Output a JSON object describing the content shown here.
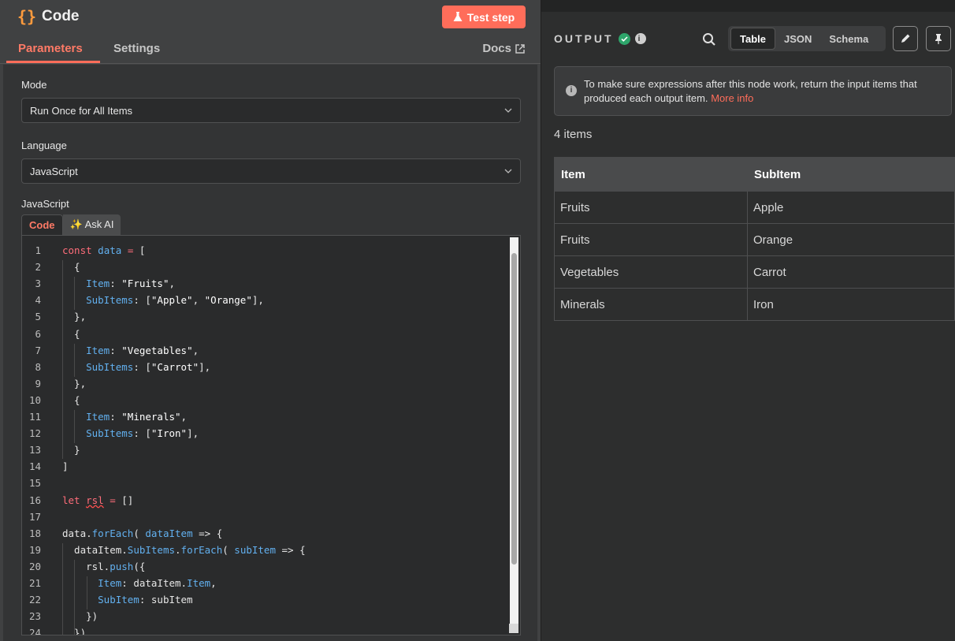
{
  "node": {
    "title": "Code",
    "test_label": "Test step"
  },
  "tabs": {
    "parameters": "Parameters",
    "settings": "Settings",
    "docs": "Docs"
  },
  "mode": {
    "label": "Mode",
    "value": "Run Once for All Items"
  },
  "language": {
    "label": "Language",
    "value": "JavaScript"
  },
  "editor": {
    "label": "JavaScript",
    "tab_code": "Code",
    "tab_ai": "✨ Ask AI",
    "line_numbers": [
      "1",
      "2",
      "3",
      "4",
      "5",
      "6",
      "7",
      "8",
      "9",
      "10",
      "11",
      "12",
      "13",
      "14",
      "15",
      "16",
      "17",
      "18",
      "19",
      "20",
      "21",
      "22",
      "23",
      "24"
    ]
  },
  "output": {
    "title": "OUTPUT",
    "views": [
      "Table",
      "JSON",
      "Schema"
    ],
    "active_view": "Table",
    "notice": "To make sure expressions after this node work, return the input items that produced each output item.",
    "notice_link": "More info",
    "count": "4 items",
    "columns": [
      "Item",
      "SubItem"
    ],
    "rows": [
      [
        "Fruits",
        "Apple"
      ],
      [
        "Fruits",
        "Orange"
      ],
      [
        "Vegetables",
        "Carrot"
      ],
      [
        "Minerals",
        "Iron"
      ]
    ]
  },
  "colors": {
    "accent": "#ff6d5a",
    "success": "#2ea56b",
    "keyword": "#ff6d7a",
    "property": "#62b0ef"
  },
  "icons": [
    "code-braces-icon",
    "flask-icon",
    "external-link-icon",
    "chevron-down-icon",
    "check-circle-icon",
    "info-icon",
    "search-icon",
    "pencil-icon",
    "pin-icon"
  ]
}
